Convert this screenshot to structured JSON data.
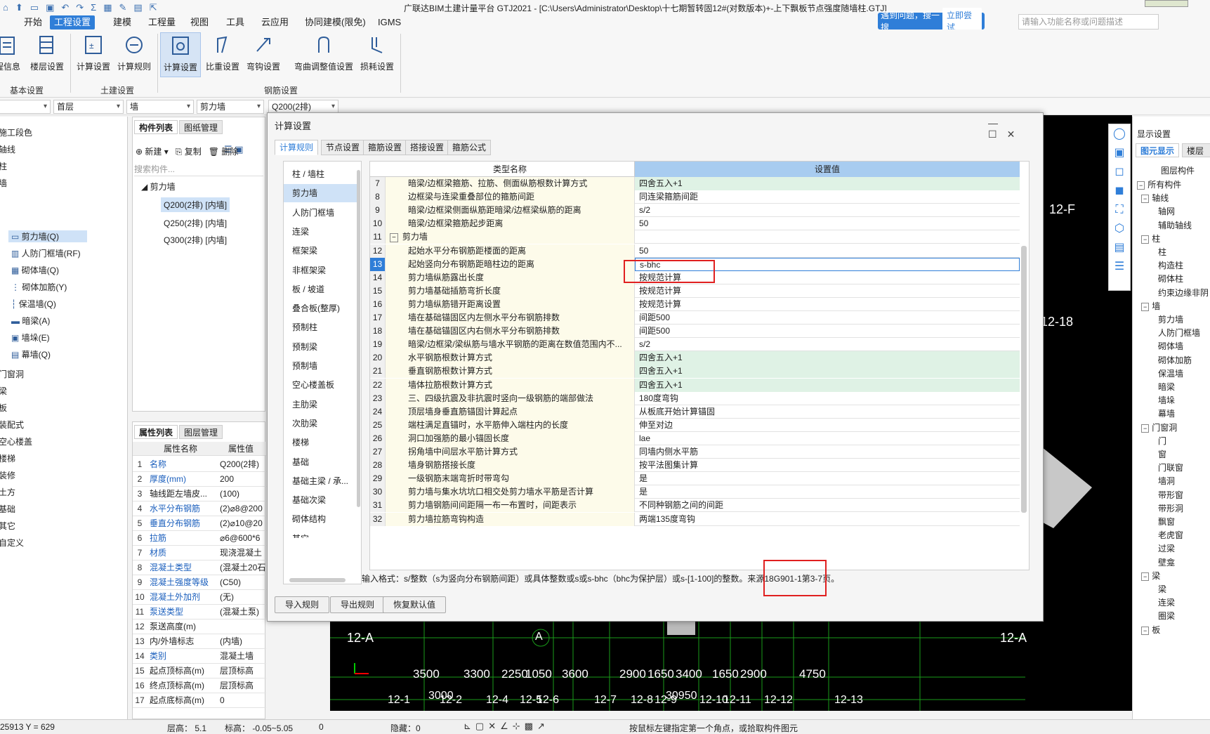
{
  "title": "广联达BIM土建计量平台 GTJ2021 - [C:\\Users\\Administrator\\Desktop\\十七期暂转固12#(对数版本)+-上下飘板节点强度随墙柱.GTJ]",
  "menu": [
    "开始",
    "工程设置",
    "建模",
    "工程量",
    "视图",
    "工具",
    "云应用",
    "协同建模(限免)",
    "IGMS"
  ],
  "ribbon": {
    "buttons": [
      "程信息",
      "楼层设置",
      "计算设置",
      "计算规则",
      "计算设置",
      "比重设置",
      "弯钩设置",
      "弯曲调整值设置",
      "损耗设置"
    ],
    "groups": [
      "基本设置",
      "土建设置",
      "钢筋设置"
    ]
  },
  "search_tip": {
    "text": "遇到问题，搜一搜",
    "button": "立即尝试"
  },
  "help_placeholder": "请输入功能名称或问题描述",
  "selectors": [
    "首层",
    "墙",
    "剪力墙",
    "Q200(2排)"
  ],
  "leftnav": [
    "施工段色",
    "轴线",
    "柱",
    "墙",
    "剪力墙(Q)",
    "人防门框墙(RF)",
    "砌体墙(Q)",
    "砌体加筋(Y)",
    "保温墙(Q)",
    "暗梁(A)",
    "墙垛(E)",
    "幕墙(Q)",
    "门窗洞",
    "梁",
    "板",
    "装配式",
    "空心楼盖",
    "楼梯",
    "装修",
    "土方",
    "基础",
    "其它",
    "自定义"
  ],
  "complist": {
    "tabs": [
      "构件列表",
      "图纸管理"
    ],
    "toolbar": [
      "新建",
      "复制",
      "删除"
    ],
    "search_placeholder": "搜索构件...",
    "tree_root": "剪力墙",
    "items": [
      "Q200(2排) [内墙]",
      "Q250(2排) [内墙]",
      "Q300(2排) [内墙]"
    ]
  },
  "props": {
    "tabs": [
      "属性列表",
      "图层管理"
    ],
    "headers": [
      "属性名称",
      "属性值"
    ],
    "rows": [
      {
        "n": "1",
        "k": "名称",
        "v": "Q200(2排)",
        "link": true
      },
      {
        "n": "2",
        "k": "厚度(mm)",
        "v": "200",
        "link": true
      },
      {
        "n": "3",
        "k": "轴线距左墙皮...",
        "v": "(100)",
        "link": false
      },
      {
        "n": "4",
        "k": "水平分布钢筋",
        "v": "(2)⌀8@200",
        "link": true
      },
      {
        "n": "5",
        "k": "垂直分布钢筋",
        "v": "(2)⌀10@20",
        "link": true
      },
      {
        "n": "6",
        "k": "拉筋",
        "v": "⌀6@600*6",
        "link": true
      },
      {
        "n": "7",
        "k": "材质",
        "v": "现浇混凝土",
        "link": true
      },
      {
        "n": "8",
        "k": "混凝土类型",
        "v": "(混凝土20石",
        "link": true
      },
      {
        "n": "9",
        "k": "混凝土强度等级",
        "v": "(C50)",
        "link": true
      },
      {
        "n": "10",
        "k": "混凝土外加剂",
        "v": "(无)",
        "link": true
      },
      {
        "n": "11",
        "k": "泵送类型",
        "v": "(混凝土泵)",
        "link": true
      },
      {
        "n": "12",
        "k": "泵送高度(m)",
        "v": "",
        "link": false
      },
      {
        "n": "13",
        "k": "内/外墙标志",
        "v": "(内墙)",
        "link": false
      },
      {
        "n": "14",
        "k": "类别",
        "v": "混凝土墙",
        "link": true
      },
      {
        "n": "15",
        "k": "起点顶标高(m)",
        "v": "层顶标高",
        "link": false
      },
      {
        "n": "16",
        "k": "终点顶标高(m)",
        "v": "层顶标高",
        "link": false
      },
      {
        "n": "17",
        "k": "起点底标高(m)",
        "v": "0",
        "link": false
      }
    ]
  },
  "dialog": {
    "title": "计算设置",
    "tabs": [
      "计算规则",
      "节点设置",
      "箍筋设置",
      "搭接设置",
      "箍筋公式"
    ],
    "categories": [
      "柱 / 墙柱",
      "剪力墙",
      "人防门框墙",
      "连梁",
      "框架梁",
      "非框架梁",
      "板 / 坡道",
      "叠合板(整厚)",
      "预制柱",
      "预制梁",
      "预制墙",
      "空心楼盖板",
      "主肋梁",
      "次肋梁",
      "楼梯",
      "基础",
      "基础主梁 / 承...",
      "基础次梁",
      "砌体结构",
      "其它"
    ],
    "grid_headers": [
      "类型名称",
      "设置值"
    ],
    "rows": [
      {
        "n": "7",
        "k": "暗梁/边框梁箍筋、拉筋、侧面纵筋根数计算方式",
        "v": "四舍五入+1",
        "g": true
      },
      {
        "n": "8",
        "k": "边框梁与连梁重叠部位的箍筋间距",
        "v": "同连梁箍筋间距",
        "g": false
      },
      {
        "n": "9",
        "k": "暗梁/边框梁侧面纵筋距暗梁/边框梁纵筋的距离",
        "v": "s/2",
        "g": false
      },
      {
        "n": "10",
        "k": "暗梁/边框梁箍筋起步距离",
        "v": "50",
        "g": false
      },
      {
        "n": "11",
        "k": "剪力墙",
        "v": "",
        "g": false,
        "section": true
      },
      {
        "n": "12",
        "k": "起始水平分布钢筋距楼面的距离",
        "v": "50",
        "g": false
      },
      {
        "n": "13",
        "k": "起始竖向分布钢筋距暗柱边的距离",
        "v": "s-bhc",
        "g": false,
        "cur": true
      },
      {
        "n": "14",
        "k": "剪力墙纵筋露出长度",
        "v": "按规范计算",
        "g": false
      },
      {
        "n": "15",
        "k": "剪力墙基础插筋弯折长度",
        "v": "按规范计算",
        "g": false
      },
      {
        "n": "16",
        "k": "剪力墙纵筋错开距离设置",
        "v": "按规范计算",
        "g": false
      },
      {
        "n": "17",
        "k": "墙在基础锚固区内左侧水平分布钢筋排数",
        "v": "间距500",
        "g": false
      },
      {
        "n": "18",
        "k": "墙在基础锚固区内右侧水平分布钢筋排数",
        "v": "间距500",
        "g": false
      },
      {
        "n": "19",
        "k": "暗梁/边框梁/梁纵筋与墙水平钢筋的距离在数值范围内不...",
        "v": "s/2",
        "g": false
      },
      {
        "n": "20",
        "k": "水平钢筋根数计算方式",
        "v": "四舍五入+1",
        "g": true
      },
      {
        "n": "21",
        "k": "垂直钢筋根数计算方式",
        "v": "四舍五入+1",
        "g": true
      },
      {
        "n": "22",
        "k": "墙体拉筋根数计算方式",
        "v": "四舍五入+1",
        "g": true
      },
      {
        "n": "23",
        "k": "三、四级抗震及非抗震时竖向一级钢筋的端部做法",
        "v": "180度弯钩",
        "g": false
      },
      {
        "n": "24",
        "k": "顶层墙身垂直筋锚固计算起点",
        "v": "从板底开始计算锚固",
        "g": false
      },
      {
        "n": "25",
        "k": "端柱满足直锚时，水平筋伸入端柱内的长度",
        "v": "伸至对边",
        "g": false
      },
      {
        "n": "26",
        "k": "洞口加强筋的最小锚固长度",
        "v": "lae",
        "g": false
      },
      {
        "n": "27",
        "k": "拐角墙中间层水平筋计算方式",
        "v": "同墙内侧水平筋",
        "g": false
      },
      {
        "n": "28",
        "k": "墙身钢筋搭接长度",
        "v": "按平法图集计算",
        "g": false
      },
      {
        "n": "29",
        "k": "一级钢筋末端弯折时带弯勾",
        "v": "是",
        "g": false
      },
      {
        "n": "30",
        "k": "剪力墙与集水坑坑口相交处剪力墙水平筋是否计算",
        "v": "是",
        "g": false
      },
      {
        "n": "31",
        "k": "剪力墙钢筋间间距隔一布一布置时，间距表示",
        "v": "不同种钢筋之间的间距",
        "g": false
      },
      {
        "n": "32",
        "k": "剪力墙拉筋弯钩构造",
        "v": "两端135度弯钩",
        "g": false
      }
    ],
    "hint": "输入格式：s/整数（s为竖向分布钢筋间距）或具体整数或s或s-bhc（bhc为保护层）或s-[1-100]的整数。来源18G901-1第3-7页。",
    "buttons": [
      "导入规则",
      "导出规则",
      "恢复默认值"
    ]
  },
  "cad": {
    "axes_top": [
      "12-F",
      "12-18"
    ],
    "axis_row": [
      "12-A",
      "A",
      "12-A"
    ],
    "dims_top": [
      "3500",
      "3300",
      "2250",
      "1050",
      "3600",
      "2900",
      "1650",
      "3400",
      "1650",
      "2900",
      "4750"
    ],
    "dims_bottom": [
      "3000",
      "30950"
    ],
    "axes_bottom": [
      "12-1",
      "12-2",
      "12-4",
      "12-5",
      "12-6",
      "12-7",
      "12-8",
      "12-9",
      "12-10",
      "12-11",
      "12-12",
      "12-13"
    ]
  },
  "rightpanel": {
    "title": "显示设置",
    "tabs": [
      "图元显示",
      "楼层显"
    ],
    "header": "图层构件",
    "items": [
      {
        "t": "所有构件",
        "l": 0,
        "box": true
      },
      {
        "t": "轴线",
        "l": 1,
        "box": true
      },
      {
        "t": "轴网",
        "l": 2,
        "box": false
      },
      {
        "t": "辅助轴线",
        "l": 2,
        "box": false
      },
      {
        "t": "柱",
        "l": 1,
        "box": true
      },
      {
        "t": "柱",
        "l": 2,
        "box": false
      },
      {
        "t": "构造柱",
        "l": 2,
        "box": false
      },
      {
        "t": "砌体柱",
        "l": 2,
        "box": false
      },
      {
        "t": "约束边缘非阴",
        "l": 2,
        "box": false
      },
      {
        "t": "墙",
        "l": 1,
        "box": true
      },
      {
        "t": "剪力墙",
        "l": 2,
        "box": false
      },
      {
        "t": "人防门框墙",
        "l": 2,
        "box": false
      },
      {
        "t": "砌体墙",
        "l": 2,
        "box": false
      },
      {
        "t": "砌体加筋",
        "l": 2,
        "box": false
      },
      {
        "t": "保温墙",
        "l": 2,
        "box": false
      },
      {
        "t": "暗梁",
        "l": 2,
        "box": false
      },
      {
        "t": "墙垛",
        "l": 2,
        "box": false
      },
      {
        "t": "幕墙",
        "l": 2,
        "box": false
      },
      {
        "t": "门窗洞",
        "l": 1,
        "box": true
      },
      {
        "t": "门",
        "l": 2,
        "box": false
      },
      {
        "t": "窗",
        "l": 2,
        "box": false
      },
      {
        "t": "门联窗",
        "l": 2,
        "box": false
      },
      {
        "t": "墙洞",
        "l": 2,
        "box": false
      },
      {
        "t": "带形窗",
        "l": 2,
        "box": false
      },
      {
        "t": "带形洞",
        "l": 2,
        "box": false
      },
      {
        "t": "飘窗",
        "l": 2,
        "box": false
      },
      {
        "t": "老虎窗",
        "l": 2,
        "box": false
      },
      {
        "t": "过梁",
        "l": 2,
        "box": false
      },
      {
        "t": "壁龛",
        "l": 2,
        "box": false
      },
      {
        "t": "梁",
        "l": 1,
        "box": true
      },
      {
        "t": "梁",
        "l": 2,
        "box": false
      },
      {
        "t": "连梁",
        "l": 2,
        "box": false
      },
      {
        "t": "圈梁",
        "l": 2,
        "box": false
      },
      {
        "t": "板",
        "l": 1,
        "box": true
      }
    ]
  },
  "status": {
    "coords": "25913 Y = 629",
    "floor_height": "层高：  5.1",
    "elevation": "标高：  -0.05~5.05",
    "zero": "0",
    "hidden": "隐藏：0",
    "hint": "按鼠标左键指定第一个角点，或拾取构件图元"
  },
  "colors": {
    "accent": "#2f7ed8",
    "red": "#e02020",
    "cad_bg": "#000000",
    "green_row": "#dff2e5"
  }
}
